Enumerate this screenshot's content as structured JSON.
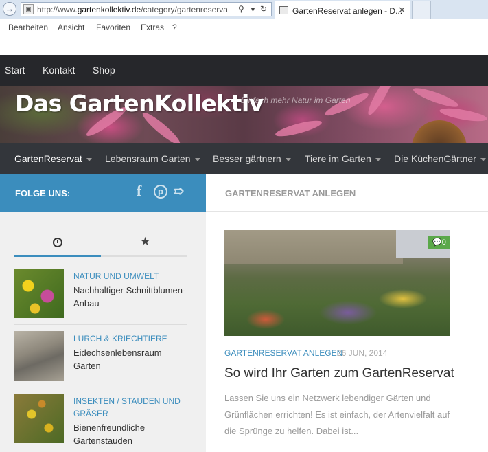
{
  "browser": {
    "url_prefix": "http://www.",
    "url_domain": "gartenkollektiv.de",
    "url_path": "/category/gartenreserva",
    "tab_title": "GartenReservat anlegen - D...",
    "menu": [
      "Bearbeiten",
      "Ansicht",
      "Favoriten",
      "Extras",
      "?"
    ]
  },
  "topnav": [
    "Start",
    "Kontakt",
    "Shop"
  ],
  "header": {
    "title": "Das GartenKollektiv",
    "tagline": "Einfach mehr Natur im Garten"
  },
  "mainnav": [
    "GartenReservat",
    "Lebensraum Garten",
    "Besser gärtnern",
    "Tiere im Garten",
    "Die KüchenGärtner"
  ],
  "sidebar": {
    "follow_label": "FOLGE UNS:",
    "social": [
      "facebook-icon",
      "pinterest-icon",
      "rss-icon"
    ],
    "posts": [
      {
        "category": "NATUR UND UMWELT",
        "title": "Nachhaltiger Schnittblumen-Anbau"
      },
      {
        "category": "LURCH & KRIECHTIERE",
        "title": "Eidechsenlebensraum Garten"
      },
      {
        "category": "INSEKTEN / STAUDEN UND GRÄSER",
        "title": "Bienenfreundliche Gartenstauden"
      }
    ]
  },
  "content": {
    "heading": "GARTENRESERVAT ANLEGEN",
    "comment_count": "0",
    "post": {
      "category": "GARTENRESERVAT ANLEGEN",
      "date": "26 JUN, 2014",
      "title": "So wird Ihr Garten zum GartenReservat",
      "excerpt": "Lassen Sie uns ein Netzwerk lebendiger Gärten und Grünflächen errichten! Es ist einfach, der Artenvielfalt auf die Sprünge zu helfen. Dabei ist..."
    }
  },
  "colors": {
    "accent": "#3b8dbd",
    "nav_dark": "#26272b",
    "nav_main": "#33363b",
    "comment_badge": "#5aa84a"
  }
}
